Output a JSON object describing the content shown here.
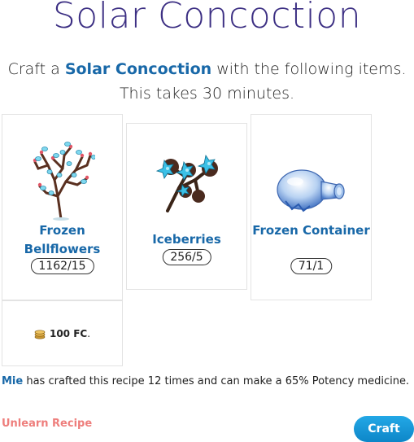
{
  "title": "Solar Concoction",
  "intro": {
    "prefix": "Craft a ",
    "item_name": "Solar Concoction",
    "suffix": " with the following items.",
    "duration": "This takes 30 minutes."
  },
  "ingredients": [
    {
      "name": "Frozen Bellflowers",
      "count": "1162/15",
      "icon": "frozen-bellflowers-icon"
    },
    {
      "name": "Iceberries",
      "count": "256/5",
      "icon": "iceberries-icon"
    },
    {
      "name": "Frozen Container",
      "count": "71/1",
      "icon": "frozen-container-icon"
    }
  ],
  "fee": {
    "amount": "100 FC",
    "trail": ".",
    "icon": "coin-stack-icon"
  },
  "crafted": {
    "user": "Mie",
    "text": " has crafted this recipe 12 times and can make a 65% Potency medicine."
  },
  "actions": {
    "unlearn_label": "Unlearn Recipe",
    "craft_label": "Craft"
  },
  "colors": {
    "title": "#3c2f83",
    "link": "#1868a8",
    "unlearn": "#ee7e7c",
    "craft_button": "#1a9ad9"
  }
}
